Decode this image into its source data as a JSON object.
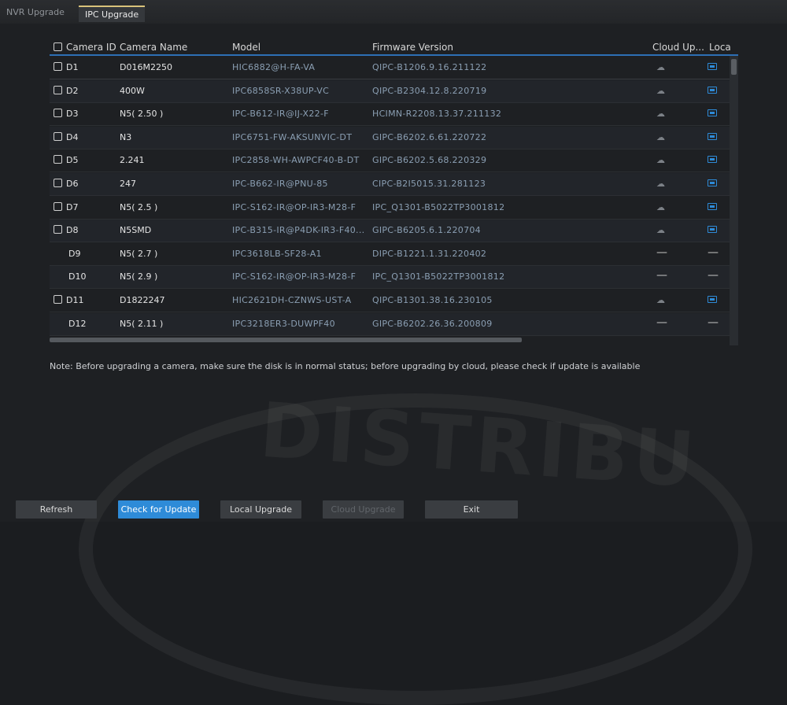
{
  "tabs": [
    {
      "label": "NVR Upgrade"
    },
    {
      "label": "IPC Upgrade"
    }
  ],
  "table": {
    "headers": {
      "camera_id": "Camera ID",
      "camera_name": "Camera Name",
      "model": "Model",
      "firmware": "Firmware Version",
      "cloud": "Cloud Up...",
      "local": "Loca"
    },
    "rows": [
      {
        "id": "D1",
        "name": "D016M2250",
        "model": "HIC6882@H-FA-VA",
        "fw": "QIPC-B1206.9.16.211122"
      },
      {
        "id": "D2",
        "name": "400W",
        "model": "IPC6858SR-X38UP-VC",
        "fw": "QIPC-B2304.12.8.220719"
      },
      {
        "id": "D3",
        "name": "N5( 2.50 )",
        "model": "IPC-B612-IR@IJ-X22-F",
        "fw": "HCIMN-R2208.13.37.211132"
      },
      {
        "id": "D4",
        "name": "N3",
        "model": "IPC6751-FW-AKSUNVIC-DT",
        "fw": "GIPC-B6202.6.61.220722"
      },
      {
        "id": "D5",
        "name": "2.241",
        "model": "IPC2858-WH-AWPCF40-B-DT",
        "fw": "GIPC-B6202.5.68.220329"
      },
      {
        "id": "D6",
        "name": "247",
        "model": "IPC-B662-IR@PNU-85",
        "fw": "CIPC-B2I5015.31.281123"
      },
      {
        "id": "D7",
        "name": "N5( 2.5 )",
        "model": "IPC-S162-IR@OP-IR3-M28-F",
        "fw": "IPC_Q1301-B5022TP3001812"
      },
      {
        "id": "D8",
        "name": "N5SMD",
        "model": "IPC-B315-IR@P4DK-IR3-F40...",
        "fw": "GIPC-B6205.6.1.220704"
      },
      {
        "id": "D9",
        "name": "N5( 2.7 )",
        "model": "IPC3618LB-SF28-A1",
        "fw": "DIPC-B1221.1.31.220402"
      },
      {
        "id": "D10",
        "name": "N5( 2.9 )",
        "model": "IPC-S162-IR@OP-IR3-M28-F",
        "fw": "IPC_Q1301-B5022TP3001812"
      },
      {
        "id": "D11",
        "name": "D1822247",
        "model": "HIC2621DH-CZNWS-UST-A",
        "fw": "QIPC-B1301.38.16.230105"
      },
      {
        "id": "D12",
        "name": "N5( 2.11 )",
        "model": "IPC3218ER3-DUWPF40",
        "fw": "GIPC-B6202.26.36.200809"
      }
    ]
  },
  "note": "Note: Before upgrading a camera, make sure the disk is in normal status; before upgrading by cloud, please check if update is available",
  "buttons": {
    "refresh": "Refresh",
    "check": "Check for Update",
    "local": "Local Upgrade",
    "cloud": "Cloud Upgrade",
    "exit": "Exit"
  },
  "colors": {
    "accent": "#2e8bd8",
    "background": "#1e2023"
  }
}
